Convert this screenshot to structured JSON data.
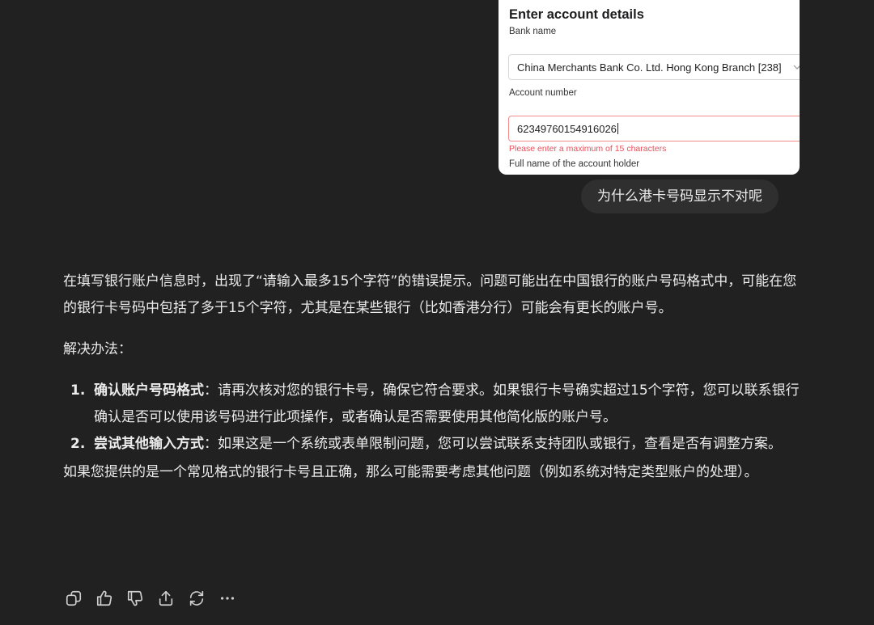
{
  "attachment": {
    "form_title": "Enter account details",
    "bank_name_label": "Bank name",
    "bank_name_value": "China Merchants Bank Co. Ltd. Hong Kong Branch [238]",
    "account_number_label": "Account number",
    "account_number_value": "62349760154916026",
    "error_message": "Please enter a maximum of 15 characters",
    "holder_label": "Full name of the account holder"
  },
  "user_message": "为什么港卡号码显示不对呢",
  "assistant": {
    "intro": "在填写银行账户信息时，出现了“请输入最多15个字符”的错误提示。问题可能出在中国银行的账户号码格式中，可能在您的银行卡号码中包括了多于15个字符，尤其是在某些银行（比如香港分行）可能会有更长的账户号。",
    "solutions_heading": "解决办法：",
    "items": [
      {
        "title": "确认账户号码格式",
        "text": "：请再次核对您的银行卡号，确保它符合要求。如果银行卡号确实超过15个字符，您可以联系银行确认是否可以使用该号码进行此项操作，或者确认是否需要使用其他简化版的账户号。"
      },
      {
        "title": "尝试其他输入方式",
        "text": "：如果这是一个系统或表单限制问题，您可以尝试联系支持团队或银行，查看是否有调整方案。"
      }
    ],
    "closing": "如果您提供的是一个常见格式的银行卡号且正确，那么可能需要考虑其他问题（例如系统对特定类型账户的处理）。"
  },
  "actions": [
    "copy-icon",
    "thumbs-up-icon",
    "thumbs-down-icon",
    "share-icon",
    "regenerate-icon",
    "more-icon"
  ],
  "colors": {
    "background": "#212121",
    "bubble": "#2f2f2f",
    "text": "#ececec",
    "error": "#e8505b",
    "error_border": "#f08c8c"
  }
}
